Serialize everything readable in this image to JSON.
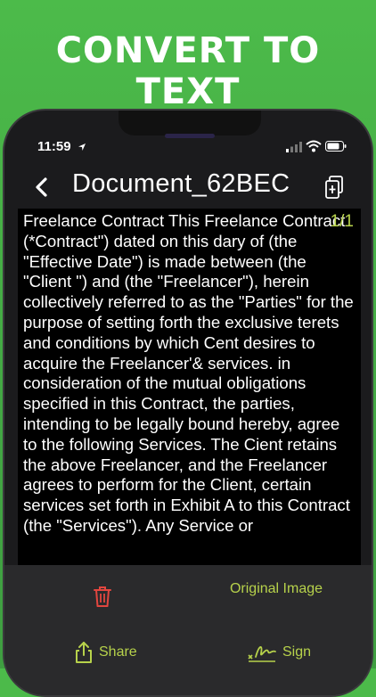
{
  "banner": {
    "title": "CONVERT TO TEXT"
  },
  "status": {
    "time": "11:59"
  },
  "header": {
    "title": "Document_62BEC"
  },
  "document": {
    "page_indicator": "1/1",
    "text": "Freelance Contract This Freelance Contract (*Contract\") dated on this dary of (the \"Effective Date\") is made between (the \"Client \") and (the \"Freelancer\"), herein collectively referred to as the \"Parties\" for the purpose of setting forth the exclusive terets and conditions by which Cent desires to acquire the Freelancer'& services. in consideration of the mutual obligations specified in this Contract, the parties, intending to be legally bound hereby, agree to the following Services. The Cient retains the above Freelancer, and the Freelancer agrees to perform for the Client, certain services set forth in Exhibit A to this Contract (the \"Services\"). Any Service or"
  },
  "toolbar": {
    "original_label": "Original Image",
    "share_label": "Share",
    "sign_label": "Sign"
  },
  "colors": {
    "accent": "#b7d24b",
    "delete": "#e2463f",
    "background_green": "#43a844"
  },
  "icons": {
    "back": "chevron-left-icon",
    "copy": "copy-document-icon",
    "delete": "trash-icon",
    "share": "share-icon",
    "sign": "signature-icon"
  }
}
